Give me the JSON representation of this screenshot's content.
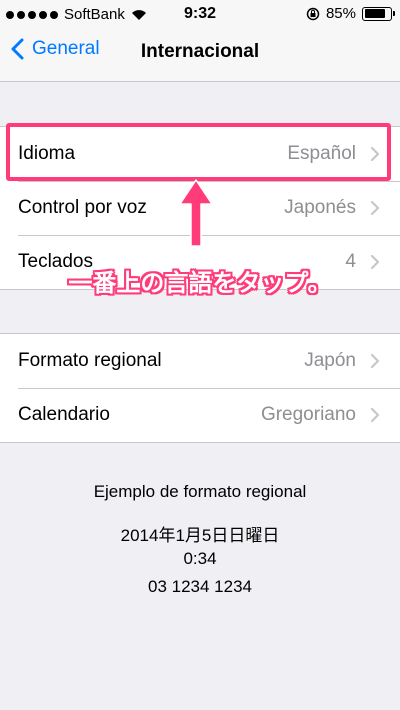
{
  "status": {
    "carrier": "SoftBank",
    "time": "9:32",
    "battery": "85%",
    "battery_level": 0.85
  },
  "nav": {
    "back_label": "General",
    "title": "Internacional"
  },
  "group1": [
    {
      "label": "Idioma",
      "value": "Español"
    },
    {
      "label": "Control por voz",
      "value": "Japonés"
    },
    {
      "label": "Teclados",
      "value": "4"
    }
  ],
  "group2": [
    {
      "label": "Formato regional",
      "value": "Japón"
    },
    {
      "label": "Calendario",
      "value": "Gregoriano"
    }
  ],
  "annotation": "一番上の言語をタップ。",
  "example": {
    "title": "Ejemplo de formato regional",
    "date": "2014年1月5日日曜日",
    "time": "0:34",
    "phone": "03 1234 1234"
  },
  "colors": {
    "accent": "#007aff",
    "highlight": "#ff3b7a"
  }
}
